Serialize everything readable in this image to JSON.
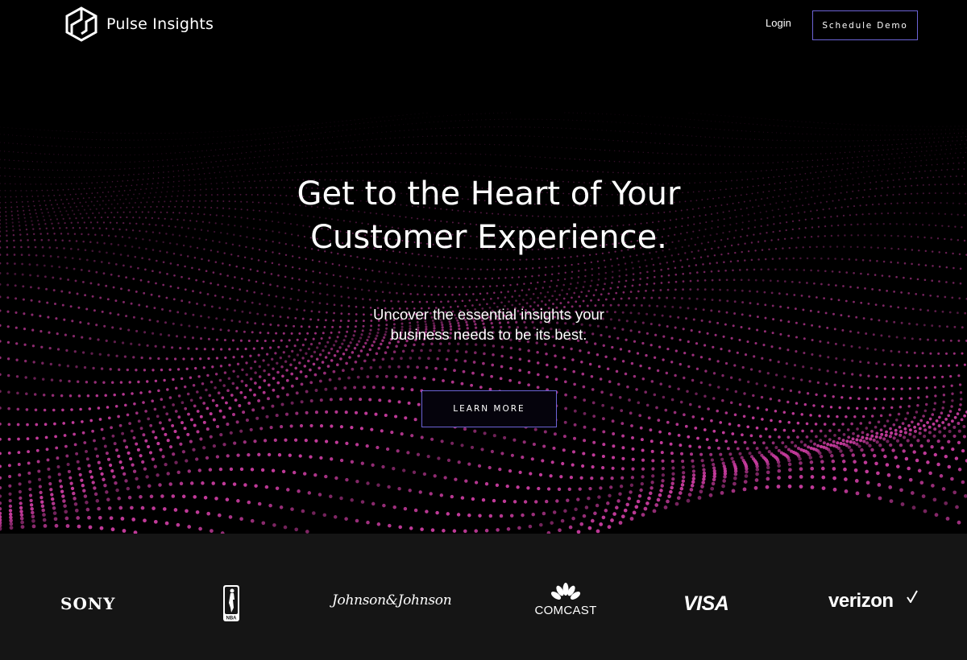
{
  "nav": {
    "brand_name": "Pulse Insights",
    "brand_icon": "hexagon-logo-icon",
    "login_label": "Login",
    "schedule_demo_label": "Schedule Demo"
  },
  "hero": {
    "headline_line1": "Get to the Heart of Your",
    "headline_line2": "Customer Experience.",
    "sub_line1": "Uncover the essential insights your",
    "sub_line2": "business needs to be its best.",
    "cta_label": "LEARN MORE"
  },
  "clients": {
    "logos": [
      {
        "name": "SONY"
      },
      {
        "name": "NBA"
      },
      {
        "name": "Johnson & Johnson",
        "display": "Johnson&Johnson"
      },
      {
        "name": "COMCAST"
      },
      {
        "name": "VISA"
      },
      {
        "name": "verizon"
      }
    ]
  },
  "colors": {
    "background": "#000000",
    "accent_border": "#6c63d6",
    "dot": "#c23a9a",
    "logo_band": "#151515"
  }
}
